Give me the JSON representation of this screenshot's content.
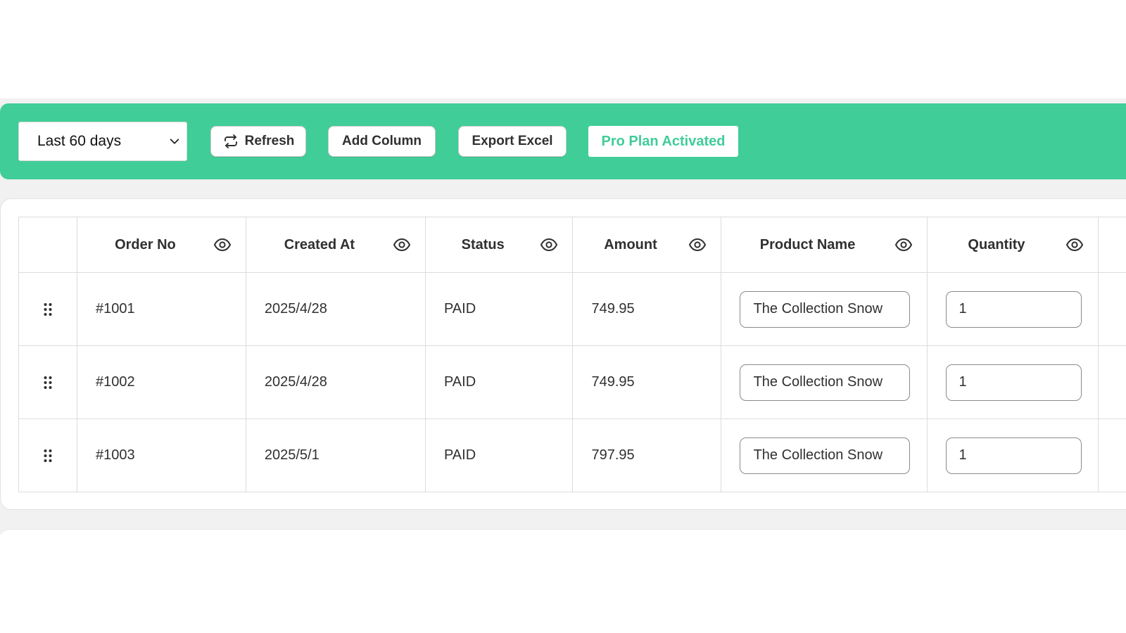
{
  "toolbar": {
    "date_range": "Last 60 days",
    "refresh_label": "Refresh",
    "add_column_label": "Add Column",
    "export_label": "Export Excel",
    "plan_label": "Pro Plan Activated",
    "accent_color": "#40cd98"
  },
  "table": {
    "columns": [
      {
        "label": "Order No",
        "icon": "eye-icon"
      },
      {
        "label": "Created At",
        "icon": "eye-icon"
      },
      {
        "label": "Status",
        "icon": "eye-icon"
      },
      {
        "label": "Amount",
        "icon": "eye-icon"
      },
      {
        "label": "Product Name",
        "icon": "eye-icon"
      },
      {
        "label": "Quantity",
        "icon": "eye-icon"
      }
    ],
    "rows": [
      {
        "order_no": "#1001",
        "created_at": "2025/4/28",
        "status": "PAID",
        "amount": "749.95",
        "product_name": "The Collection Snow",
        "quantity": "1"
      },
      {
        "order_no": "#1002",
        "created_at": "2025/4/28",
        "status": "PAID",
        "amount": "749.95",
        "product_name": "The Collection Snow",
        "quantity": "1"
      },
      {
        "order_no": "#1003",
        "created_at": "2025/5/1",
        "status": "PAID",
        "amount": "797.95",
        "product_name": "The Collection Snow",
        "quantity": "1"
      }
    ]
  }
}
